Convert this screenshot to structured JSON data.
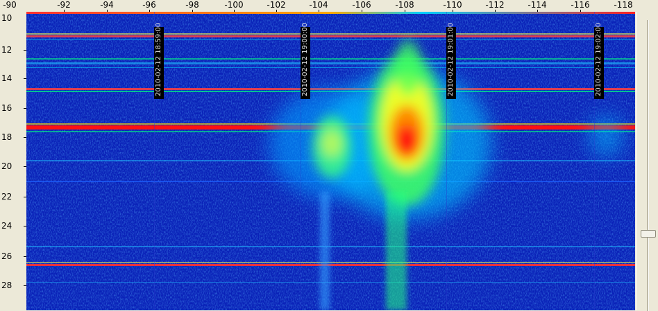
{
  "freq_axis": {
    "labels": [
      "-90",
      "-92",
      "-94",
      "-96",
      "-98",
      "-100",
      "-102",
      "-104",
      "-106",
      "-108",
      "-110",
      "-112",
      "-114",
      "-116",
      "-118"
    ]
  },
  "time_axis": {
    "labels": [
      "10",
      "12",
      "14",
      "16",
      "18",
      "20",
      "22",
      "24",
      "26",
      "28"
    ]
  },
  "timestamps": [
    "2010-02-12 18:59:00",
    "2010-02-12 19:00:00",
    "2010-02-12 19:01:00",
    "2010-02-12 19:02:00"
  ],
  "colors": {
    "background": "#0a1fb0",
    "hot": "#ff1010",
    "warm": "#ffff00",
    "cool": "#00e0ff"
  },
  "scrollbar": {
    "position": 0.74
  }
}
